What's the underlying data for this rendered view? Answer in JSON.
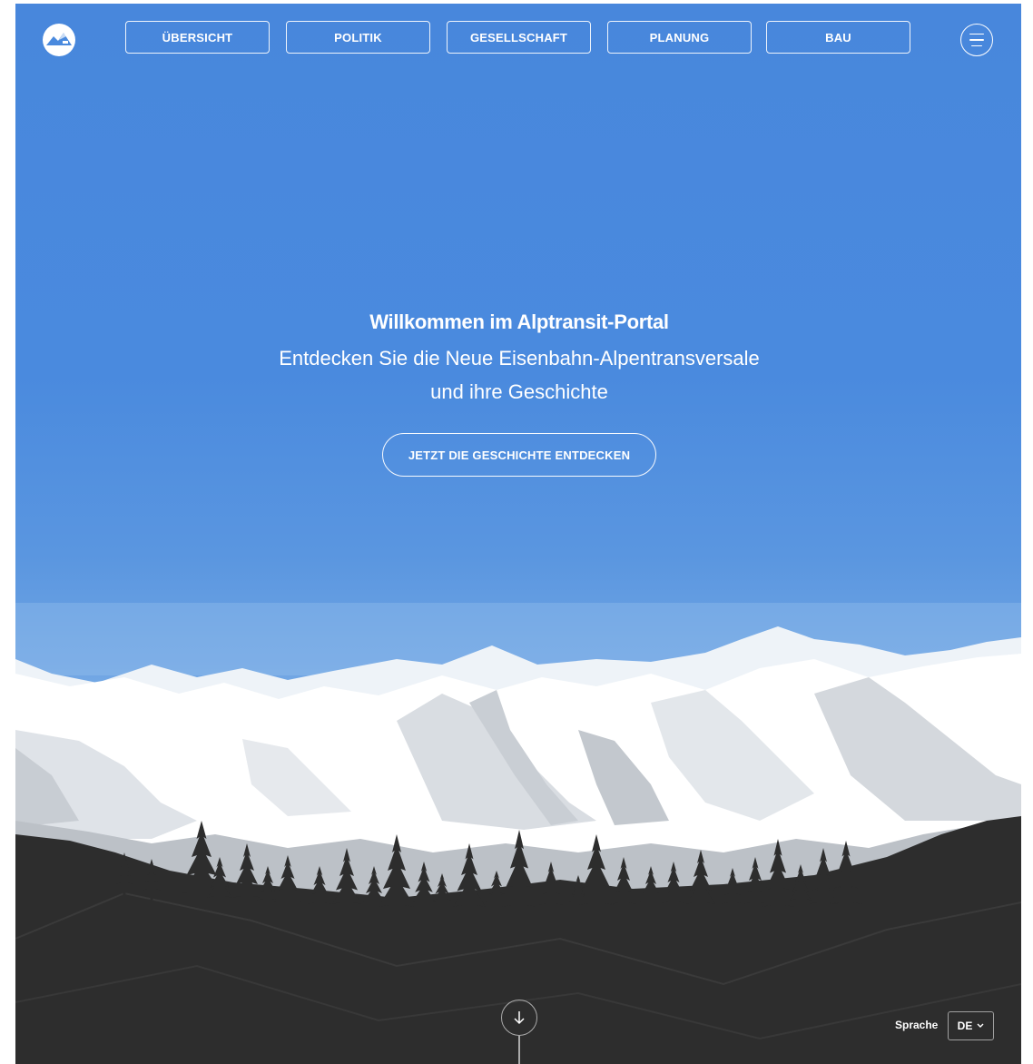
{
  "nav": {
    "items": [
      {
        "label": "ÜBERSICHT"
      },
      {
        "label": "POLITIK"
      },
      {
        "label": "GESELLSCHAFT"
      },
      {
        "label": "PLANUNG"
      },
      {
        "label": "BAU"
      }
    ]
  },
  "hero": {
    "title": "Willkommen im Alptransit-Portal",
    "subtitle_line1": "Entdecken Sie die Neue Eisenbahn-Alpentransversale",
    "subtitle_line2": "und ihre Geschichte",
    "cta_label": "JETZT DIE GESCHICHTE ENTDECKEN"
  },
  "footer": {
    "language_label": "Sprache",
    "language_value": "DE"
  },
  "icons": {
    "logo": "mountain-logo-icon",
    "menu": "hamburger-menu-icon",
    "scroll": "arrow-down-icon",
    "dropdown": "chevron-down-icon"
  },
  "colors": {
    "sky_top": "#4887dc",
    "sky_bottom": "#7fb1e8",
    "forest": "#2d2d2d",
    "snow": "#ffffff"
  }
}
